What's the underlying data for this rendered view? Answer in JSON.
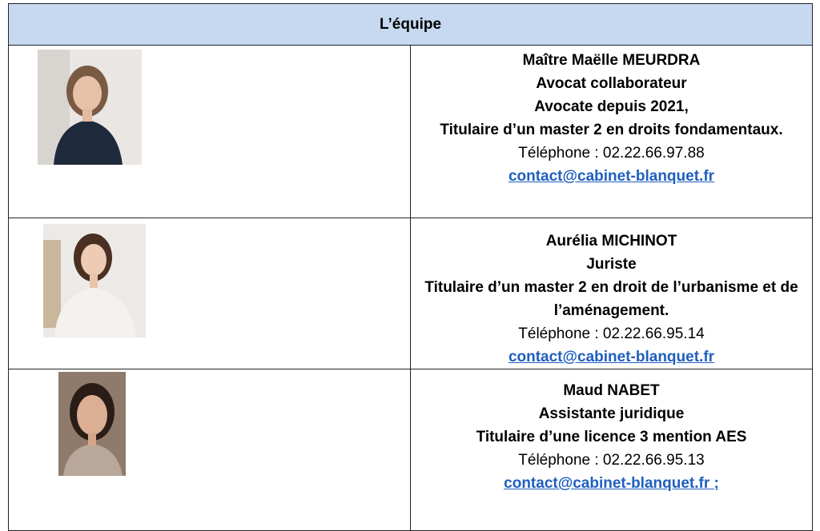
{
  "header": {
    "title": "L’équipe"
  },
  "members": [
    {
      "lines": [
        "Maître Maëlle MEURDRA",
        "Avocat collaborateur",
        "Avocate depuis 2021,",
        "Titulaire d’un master 2 en droits fondamentaux."
      ],
      "phone": "Téléphone : 02.22.66.97.88",
      "email": "contact@cabinet-blanquet.fr",
      "email_suffix": ""
    },
    {
      "lines": [
        "Aurélia MICHINOT",
        "Juriste",
        "Titulaire d’un master 2 en droit de l’urbanisme et de l’aménagement."
      ],
      "phone": "Téléphone : 02.22.66.95.14",
      "email": "contact@cabinet-blanquet.fr",
      "email_suffix": ""
    },
    {
      "lines": [
        "Maud NABET",
        "Assistante juridique",
        "Titulaire d’une licence 3 mention AES"
      ],
      "phone": "Téléphone : 02.22.66.95.13",
      "email": "contact@cabinet-blanquet.fr",
      "email_suffix": " ;"
    }
  ]
}
